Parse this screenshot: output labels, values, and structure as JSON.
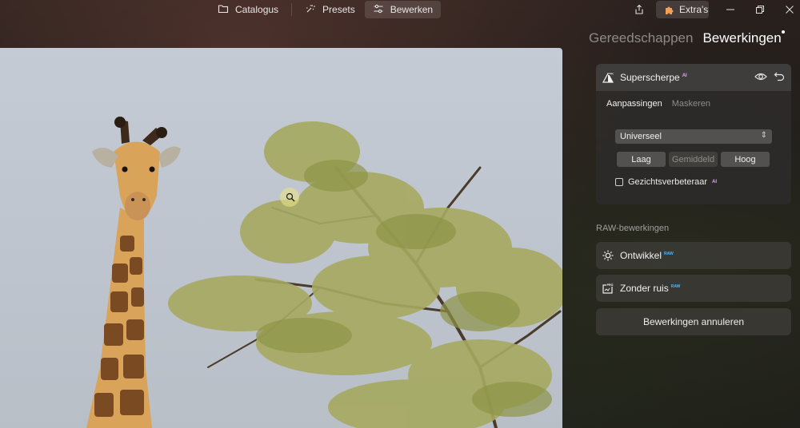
{
  "topbar": {
    "nav": [
      {
        "label": "Catalogus",
        "icon": "folder-icon",
        "active": false
      },
      {
        "label": "Presets",
        "icon": "sparkle-icon",
        "active": false
      },
      {
        "label": "Bewerken",
        "icon": "sliders-icon",
        "active": true
      }
    ],
    "extras_label": "Extra's"
  },
  "panel": {
    "tabs": [
      {
        "label": "Gereedschappen",
        "active": false
      },
      {
        "label": "Bewerkingen",
        "active": true
      }
    ],
    "tool": {
      "title": "Superscherpe",
      "badge": "AI",
      "subtabs": [
        {
          "label": "Aanpassingen",
          "active": true
        },
        {
          "label": "Maskeren",
          "active": false
        }
      ],
      "mode_value": "Universeel",
      "levels": [
        {
          "label": "Laag",
          "enabled": true
        },
        {
          "label": "Gemiddeld",
          "enabled": false
        },
        {
          "label": "Hoog",
          "enabled": true
        }
      ],
      "face_label": "Gezichtsverbeteraar",
      "face_badge": "AI",
      "face_checked": false
    },
    "raw_section_label": "RAW-bewerkingen",
    "raw_items": [
      {
        "label": "Ontwikkel",
        "badge": "RAW",
        "icon": "sun-icon"
      },
      {
        "label": "Zonder ruis",
        "badge": "RAW",
        "icon": "denoise-pro-icon"
      }
    ],
    "cancel_label": "Bewerkingen annuleren"
  },
  "colors": {
    "ai_badge": "#e2a6ff",
    "raw_badge": "#4db5ff",
    "sky": "#c4cbd4"
  }
}
